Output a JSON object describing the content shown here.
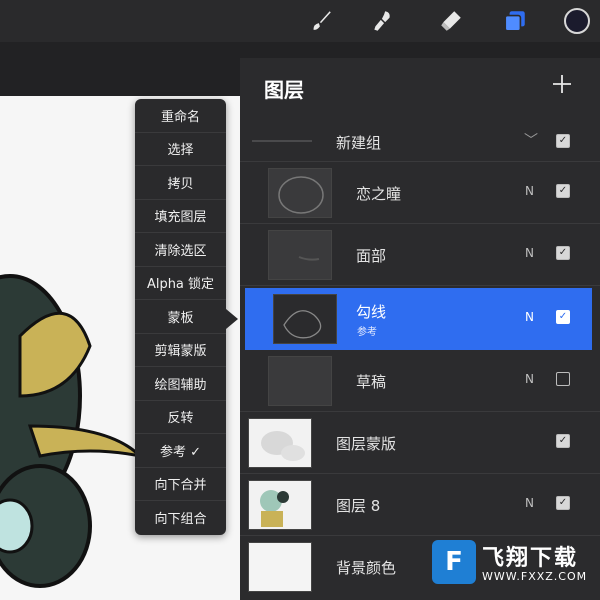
{
  "toolbar": {
    "tools": [
      {
        "name": "brush",
        "icon": "brush-icon"
      },
      {
        "name": "smudge",
        "icon": "smudge-icon"
      },
      {
        "name": "eraser",
        "icon": "eraser-icon"
      },
      {
        "name": "layers",
        "icon": "layers-icon",
        "active_color": "#2f6df0"
      },
      {
        "name": "color",
        "icon": "color-swatch",
        "color": "#1b1b2d"
      }
    ]
  },
  "context_menu": {
    "items": [
      "重命名",
      "选择",
      "拷贝",
      "填充图层",
      "清除选区",
      "Alpha 锁定",
      "蒙板",
      "剪辑蒙版",
      "绘图辅助",
      "反转",
      "参考 ✓",
      "向下合并",
      "向下组合"
    ]
  },
  "layers_panel": {
    "title": "图层",
    "add_icon": "plus-icon",
    "group": {
      "name": "新建组",
      "visible": true
    },
    "layers": [
      {
        "name": "恋之瞳",
        "blend": "N",
        "visible": true
      },
      {
        "name": "面部",
        "blend": "N",
        "visible": true
      },
      {
        "name": "勾线",
        "sub": "参考",
        "blend": "N",
        "visible": true,
        "selected": true
      },
      {
        "name": "草稿",
        "blend": "N",
        "visible": false
      },
      {
        "name": "图层蒙版",
        "blend": "",
        "visible": true
      },
      {
        "name": "图层 8",
        "blend": "N",
        "visible": true
      },
      {
        "name": "背景颜色",
        "blend": "",
        "visible": null
      }
    ]
  },
  "watermark": {
    "title": "飞翔下载",
    "url": "WWW.FXXZ.COM"
  },
  "colors": {
    "accent": "#2f6df0",
    "panel": "#2b2b2d",
    "toolbar": "#2a2a2c"
  }
}
